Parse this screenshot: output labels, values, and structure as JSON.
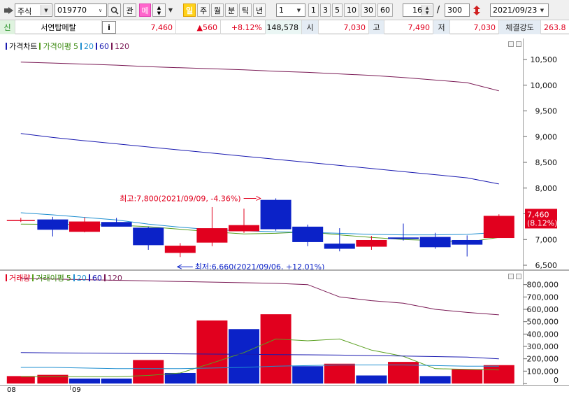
{
  "toolbar": {
    "market_select": "주식",
    "stock_code": "019770",
    "watch_btn": "관",
    "memo_btn": "메",
    "period_tabs": [
      "일",
      "주",
      "월",
      "분",
      "틱",
      "년"
    ],
    "period_active": 0,
    "unit_select": "1",
    "unit_buttons": [
      "1",
      "3",
      "5",
      "10",
      "30",
      "60"
    ],
    "display_count": "16",
    "slash": "/",
    "total_count": "300",
    "date": "2021/09/23"
  },
  "infobar": {
    "badge": "신",
    "name": "서연탑메탈",
    "info_btn": "i",
    "price": "7,460",
    "change": "▲560",
    "change_rate": "+8.12%",
    "volume": "148,578",
    "open_label": "시",
    "open": "7,030",
    "high_label": "고",
    "high": "7,490",
    "low_label": "저",
    "low": "7,030",
    "strength_label": "체결강도",
    "strength": "263.8"
  },
  "price_panel": {
    "legend_title": "가격차트",
    "legend_ma": "가격이평",
    "periods": [
      "5",
      "20",
      "60",
      "120"
    ],
    "max_annotation": "최고:7,800(2021/09/09, -4.36%)",
    "min_annotation": "최저:6,660(2021/09/06, +12.01%)",
    "price_tag": "7,460",
    "rate_tag": "(8.12%)",
    "y_ticks": [
      "10,500",
      "10,000",
      "9,500",
      "9,000",
      "8,500",
      "8,000",
      "7,500",
      "7,000",
      "6,500"
    ]
  },
  "volume_panel": {
    "legend_title": "거래량",
    "legend_ma": "거래이평",
    "periods": [
      "5",
      "20",
      "60",
      "120"
    ],
    "y_ticks": [
      "800,000",
      "700,000",
      "600,000",
      "500,000",
      "400,000",
      "300,000",
      "200,000",
      "100,000",
      "0"
    ]
  },
  "x_labels": [
    "08",
    "09"
  ],
  "colors": {
    "up": "#e1001e",
    "down": "#0b22c8",
    "ma5": "#5aa020",
    "ma20": "#1f8fd0",
    "ma60": "#1a1ab0",
    "ma120": "#7a1a55"
  },
  "chart_data": [
    {
      "type": "candlestick",
      "title": "가격차트",
      "unit": "KRW",
      "ylim": [
        6500,
        10500
      ],
      "candles": [
        {
          "o": 7380,
          "h": 7420,
          "l": 7340,
          "c": 7380
        },
        {
          "o": 7390,
          "h": 7440,
          "l": 7060,
          "c": 7190
        },
        {
          "o": 7150,
          "h": 7430,
          "l": 7140,
          "c": 7350
        },
        {
          "o": 7340,
          "h": 7420,
          "l": 7270,
          "c": 7250
        },
        {
          "o": 7230,
          "h": 7250,
          "l": 6800,
          "c": 6890
        },
        {
          "o": 6740,
          "h": 6930,
          "l": 6660,
          "c": 6880
        },
        {
          "o": 6940,
          "h": 7630,
          "l": 6870,
          "c": 7220
        },
        {
          "o": 7160,
          "h": 7600,
          "l": 7130,
          "c": 7280
        },
        {
          "o": 7770,
          "h": 7800,
          "l": 7170,
          "c": 7200
        },
        {
          "o": 7250,
          "h": 7290,
          "l": 6870,
          "c": 6950
        },
        {
          "o": 6920,
          "h": 7220,
          "l": 6770,
          "c": 6820
        },
        {
          "o": 6860,
          "h": 7070,
          "l": 6800,
          "c": 6990
        },
        {
          "o": 7040,
          "h": 7310,
          "l": 6980,
          "c": 7010
        },
        {
          "o": 7050,
          "h": 7130,
          "l": 6820,
          "c": 6850
        },
        {
          "o": 6990,
          "h": 7080,
          "l": 6670,
          "c": 6900
        },
        {
          "o": 7030,
          "h": 7490,
          "l": 7030,
          "c": 7460
        }
      ],
      "series": [
        {
          "name": "5",
          "values": [
            7300,
            7295,
            7290,
            7280,
            7250,
            7200,
            7150,
            7110,
            7120,
            7150,
            7090,
            7040,
            7000,
            6980,
            6950,
            7040
          ]
        },
        {
          "name": "20",
          "values": [
            7520,
            7480,
            7430,
            7380,
            7300,
            7240,
            7190,
            7170,
            7150,
            7140,
            7120,
            7100,
            7090,
            7090,
            7100,
            7140
          ]
        },
        {
          "name": "60",
          "values": [
            9060,
            8985,
            8920,
            8860,
            8800,
            8740,
            8680,
            8620,
            8560,
            8500,
            8440,
            8380,
            8320,
            8260,
            8200,
            8080
          ]
        },
        {
          "name": "120",
          "values": [
            10450,
            10430,
            10410,
            10390,
            10360,
            10340,
            10320,
            10300,
            10270,
            10250,
            10220,
            10190,
            10150,
            10100,
            10050,
            9890
          ]
        }
      ]
    },
    {
      "type": "bar",
      "title": "거래량",
      "ylim": [
        0,
        900000
      ],
      "values": [
        60000,
        70000,
        40000,
        40000,
        190000,
        85000,
        510000,
        440000,
        560000,
        140000,
        160000,
        65000,
        175000,
        60000,
        115000,
        148578
      ],
      "directions": [
        "up",
        "up",
        "down",
        "down",
        "up",
        "down",
        "up",
        "down",
        "up",
        "down",
        "up",
        "down",
        "up",
        "down",
        "up",
        "up"
      ],
      "series": [
        {
          "name": "5",
          "values": [
            55000,
            55000,
            55000,
            55000,
            65000,
            85000,
            165000,
            250000,
            360000,
            345000,
            360000,
            270000,
            220000,
            120000,
            115000,
            110000
          ]
        },
        {
          "name": "20",
          "values": [
            130000,
            130000,
            125000,
            120000,
            120000,
            120000,
            125000,
            130000,
            140000,
            145000,
            150000,
            150000,
            150000,
            145000,
            140000,
            140000
          ]
        },
        {
          "name": "60",
          "values": [
            250000,
            248000,
            246000,
            244000,
            242000,
            240000,
            238000,
            236000,
            234000,
            232000,
            230000,
            226000,
            222000,
            218000,
            214000,
            200000
          ]
        },
        {
          "name": "120",
          "values": [
            850000,
            845000,
            840000,
            835000,
            830000,
            825000,
            820000,
            815000,
            810000,
            800000,
            700000,
            670000,
            650000,
            600000,
            575000,
            555000
          ]
        }
      ]
    }
  ]
}
